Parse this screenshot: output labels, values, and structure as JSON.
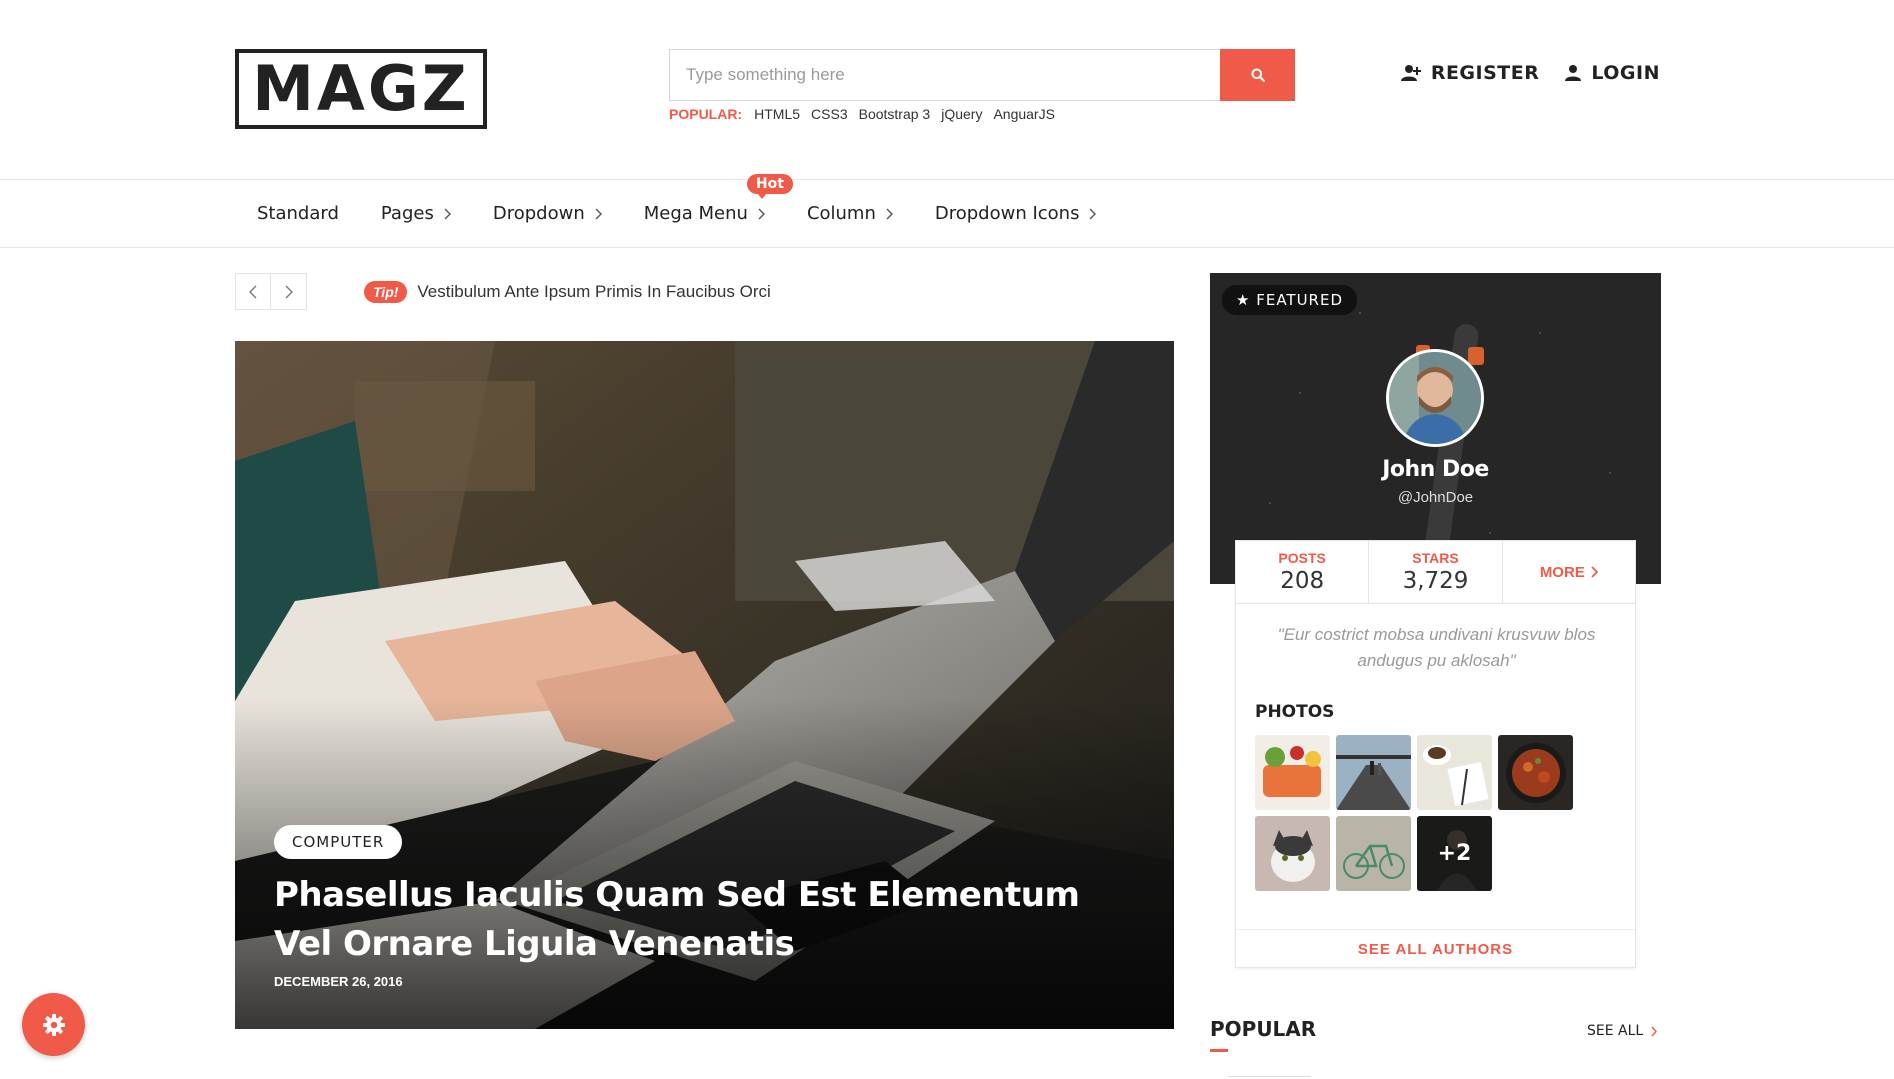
{
  "header": {
    "logo_text": "MAGZ",
    "search": {
      "placeholder": "Type something here",
      "value": "",
      "button_icon": "search-icon"
    },
    "popular": {
      "label": "POPULAR:",
      "tags": [
        "HTML5",
        "CSS3",
        "Bootstrap 3",
        "jQuery",
        "AnguarJS"
      ]
    },
    "auth": {
      "register_label": "REGISTER",
      "login_label": "LOGIN"
    }
  },
  "nav": {
    "items": [
      {
        "label": "Standard",
        "has_dropdown": false
      },
      {
        "label": "Pages",
        "has_dropdown": true
      },
      {
        "label": "Dropdown",
        "has_dropdown": true
      },
      {
        "label": "Mega Menu",
        "has_dropdown": true,
        "badge": "Hot"
      },
      {
        "label": "Column",
        "has_dropdown": true
      },
      {
        "label": "Dropdown Icons",
        "has_dropdown": true
      }
    ]
  },
  "ticker": {
    "tip_label": "Tip!",
    "text": "Vestibulum Ante Ipsum Primis In Faucibus Orci"
  },
  "hero": {
    "category": "COMPUTER",
    "title": "Phasellus Iaculis Quam Sed Est Elementum Vel Ornare Ligula Venenatis",
    "date": "DECEMBER 26, 2016"
  },
  "featured": {
    "badge": "★ FEATURED",
    "name": "John Doe",
    "handle": "@JohnDoe",
    "stats": {
      "posts_label": "POSTS",
      "posts_value": "208",
      "stars_label": "STARS",
      "stars_value": "3,729",
      "more_label": "MORE"
    },
    "quote": "\"Eur costrict mobsa undivani krusvuw blos andugus pu aklosah\"",
    "photos_title": "PHOTOS",
    "photos_more": "+2",
    "see_all_authors": "SEE ALL AUTHORS"
  },
  "popular_section": {
    "title": "POPULAR",
    "see_all": "SEE ALL"
  },
  "colors": {
    "accent": "#f05a48",
    "text": "#222222",
    "border": "#e6e6e6"
  }
}
